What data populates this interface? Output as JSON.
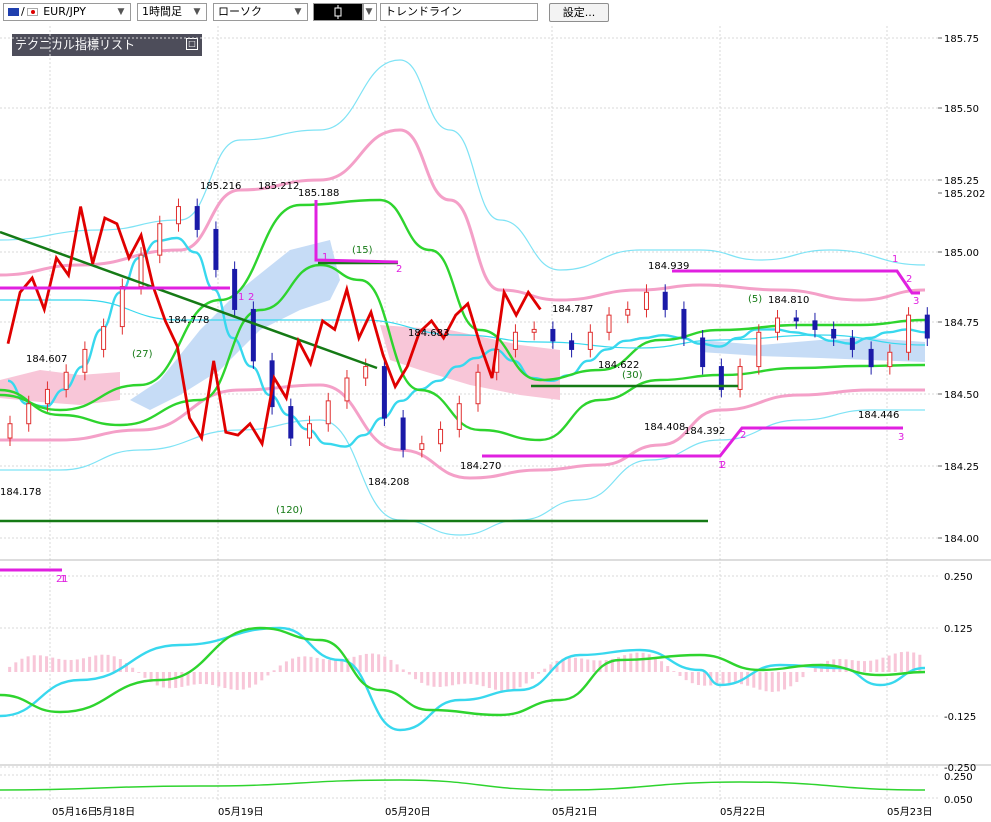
{
  "toolbar": {
    "symbol": "EUR/JPY",
    "timeframe": "1時間足",
    "chart_type": "ローソク",
    "draw_tool": "トレンドライン",
    "settings_button": "設定..."
  },
  "indicator_panel": {
    "title": "テクニカル指標リスト"
  },
  "colors": {
    "up_candle": "#e03030",
    "down_candle": "#1a1aa8",
    "bollinger_outer": "#7fe3f5",
    "bollinger_inner": "#f4a0c8",
    "ma_green": "#2ed42e",
    "ma_cyan": "#38d8ee",
    "lagging_red": "#e00000",
    "trend_magenta": "#e020e0",
    "level_darkgreen": "#157a15",
    "cloud_pink": "#f8c6d8",
    "cloud_blue": "#c6dcf6",
    "grid": "#d8d8d8"
  },
  "chart_data": [
    {
      "type": "line",
      "panel": "price",
      "y_axis_ticks": [
        "185.75",
        "185.50",
        "185.25",
        "185.202",
        "185.00",
        "184.75",
        "184.50",
        "184.25",
        "184.00"
      ],
      "ylim": [
        184.0,
        185.75
      ],
      "current_price": "185.202",
      "price_labels": [
        "185.216",
        "185.212",
        "185.188",
        "184.778",
        "184.607",
        "184.178",
        "184.683",
        "184.208",
        "184.270",
        "184.787",
        "184.622",
        "184.408",
        "184.392",
        "184.939",
        "184.810",
        "184.446"
      ],
      "period_labels": [
        "(15)",
        "(27)",
        "(30)",
        "(5)",
        "(120)"
      ],
      "wave_labels": [
        "1",
        "2",
        "1",
        "2",
        "1",
        "2",
        "3",
        "1",
        "2",
        "3",
        "2",
        "1",
        "1",
        "2"
      ],
      "x_tick_labels": [
        "05月16日",
        "5月18日",
        "05月19日",
        "05月20日",
        "05月21日",
        "05月22日",
        "05月23日"
      ],
      "series": [
        {
          "name": "lagging-span",
          "x": [
            0,
            1,
            2,
            3,
            4,
            5,
            6,
            7,
            8,
            9,
            10,
            11,
            12,
            13,
            14,
            15,
            16,
            17,
            18,
            19,
            20,
            21,
            22,
            23,
            24,
            25,
            26,
            27,
            28,
            29,
            30,
            31,
            32,
            33,
            34,
            35,
            36,
            37,
            38,
            39,
            40,
            41,
            42,
            43,
            44
          ],
          "values": [
            184.68,
            184.86,
            184.91,
            184.8,
            184.98,
            184.92,
            185.16,
            184.96,
            185.12,
            185.1,
            184.98,
            185.06,
            184.88,
            184.76,
            184.67,
            184.42,
            184.35,
            184.62,
            184.37,
            184.36,
            184.4,
            184.33,
            184.56,
            184.49,
            184.69,
            184.61,
            184.76,
            184.73,
            184.87,
            184.7,
            184.79,
            184.64,
            184.53,
            184.6,
            184.72,
            184.76,
            184.7,
            184.78,
            184.82,
            184.68,
            184.56,
            184.86,
            184.78,
            184.86,
            184.8
          ]
        },
        {
          "name": "moving-average-short",
          "x": [
            0,
            6,
            12,
            18,
            24,
            30,
            36,
            42,
            48,
            54,
            60,
            66,
            72,
            78,
            84,
            90,
            96,
            102,
            108,
            114,
            120,
            126,
            132,
            138,
            144,
            150,
            156,
            162,
            168,
            174,
            180,
            186,
            192,
            198,
            204,
            210,
            216,
            222,
            228,
            234,
            240,
            246,
            252,
            258,
            264,
            270,
            276,
            282,
            288,
            294
          ],
          "values": [
            184.55,
            184.47,
            184.46,
            184.52,
            184.6,
            184.73,
            184.86,
            184.98,
            185.04,
            185.05,
            185.0,
            184.87,
            184.7,
            184.6,
            184.5,
            184.43,
            184.38,
            184.33,
            184.32,
            184.36,
            184.42,
            184.48,
            184.52,
            184.55,
            184.6,
            184.63,
            184.66,
            184.62,
            184.56,
            184.55,
            184.57,
            184.62,
            184.66,
            184.69,
            184.7,
            184.71,
            184.7,
            184.68,
            184.67,
            184.7,
            184.73,
            184.73,
            184.72,
            184.71,
            184.69,
            184.68,
            184.7,
            184.72,
            184.73,
            184.72
          ]
        }
      ],
      "candles": {
        "x": [
          0,
          6,
          12,
          18,
          24,
          30,
          36,
          42,
          48,
          54,
          60,
          66,
          72,
          78,
          84,
          90,
          96,
          102,
          108,
          114,
          120,
          126,
          132,
          138,
          144,
          150,
          156,
          162,
          168,
          174,
          180,
          186,
          192,
          198,
          204,
          210,
          216,
          222,
          228,
          234,
          240,
          246,
          252,
          258,
          264,
          270,
          276,
          282,
          288,
          294
        ],
        "values": [
          184.4,
          184.47,
          184.52,
          184.58,
          184.66,
          184.74,
          184.88,
          184.99,
          185.1,
          185.16,
          185.08,
          184.94,
          184.8,
          184.62,
          184.46,
          184.35,
          184.4,
          184.48,
          184.56,
          184.6,
          184.42,
          184.31,
          184.33,
          184.38,
          184.47,
          184.58,
          184.66,
          184.72,
          184.73,
          184.69,
          184.66,
          184.72,
          184.78,
          184.8,
          184.86,
          184.8,
          184.7,
          184.6,
          184.52,
          184.6,
          184.72,
          184.77,
          184.76,
          184.73,
          184.7,
          184.66,
          184.6,
          184.65,
          184.78,
          184.7
        ]
      }
    },
    {
      "type": "line",
      "panel": "macd",
      "y_axis_ticks": [
        "0.250",
        "0.125",
        "-0.125",
        "-0.250"
      ],
      "ylim": [
        -0.25,
        0.25
      ]
    },
    {
      "type": "line",
      "panel": "lower",
      "y_axis_ticks": [
        "0.250",
        "0.050"
      ]
    }
  ]
}
